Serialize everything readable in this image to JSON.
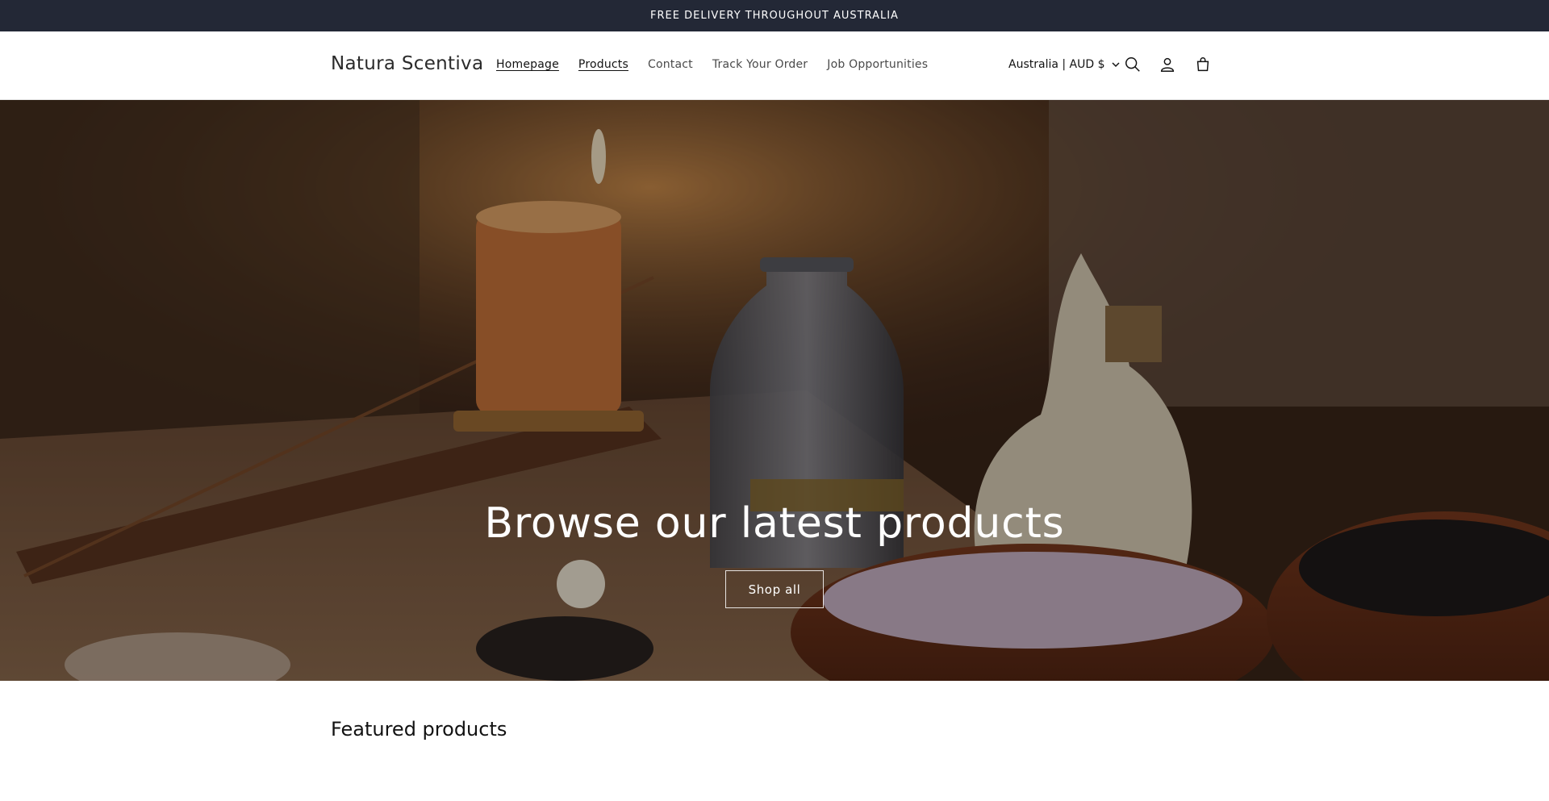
{
  "announcement": {
    "text": "FREE DELIVERY THROUGHOUT AUSTRALIA"
  },
  "header": {
    "logo": "Natura Scentiva",
    "nav": [
      {
        "label": "Homepage",
        "active": true
      },
      {
        "label": "Products",
        "active": true
      },
      {
        "label": "Contact",
        "active": false
      },
      {
        "label": "Track Your Order",
        "active": false
      },
      {
        "label": "Job Opportunities",
        "active": false
      }
    ],
    "country_selector": "Australia | AUD $",
    "icons": [
      "chevron-down-icon",
      "search-icon",
      "account-icon",
      "cart-icon"
    ]
  },
  "hero": {
    "title": "Browse our latest products",
    "button_label": "Shop all"
  },
  "featured": {
    "heading": "Featured products"
  },
  "colors": {
    "announcement_bg": "#232836",
    "text": "#121212",
    "hero_text": "#ffffff"
  }
}
